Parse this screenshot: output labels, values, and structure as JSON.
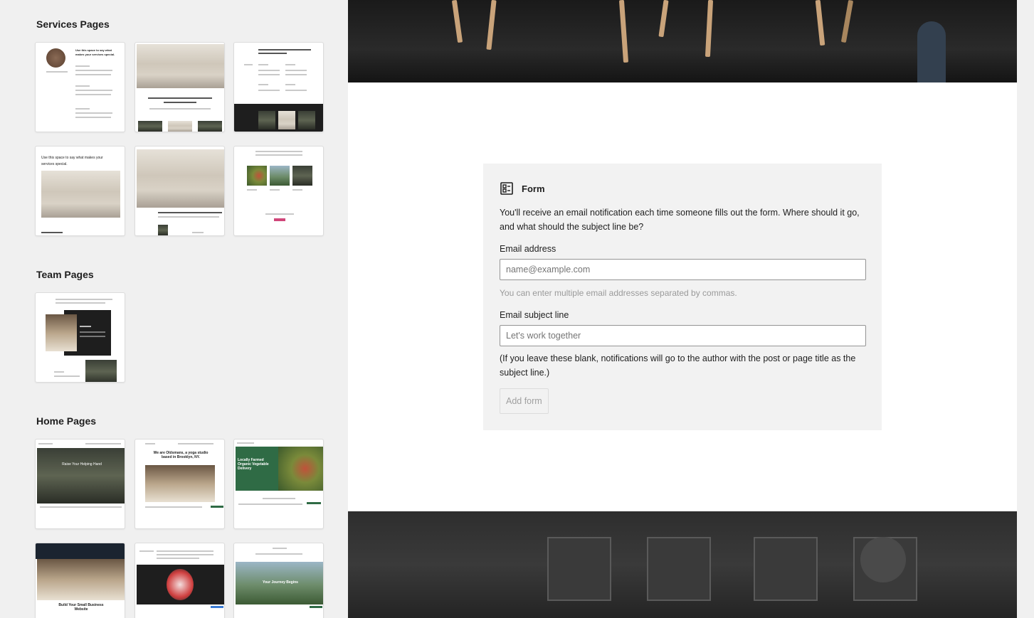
{
  "sidebar": {
    "sections": [
      {
        "title": "Services Pages"
      },
      {
        "title": "Team Pages"
      },
      {
        "title": "Home Pages"
      }
    ],
    "thumbs": {
      "s1_text": "Use this space to say what makes your services special.",
      "s4_text": "Use this space to say what makes your services special.",
      "h1_text": "Raise Your Helping Hand",
      "h2_text": "We are Oldsmans, a yoga studio based in Brooklyn, NY.",
      "h3_text": "Locally Farmed Organic Vegetable Delivery",
      "h4_text": "Build Your Small Business Website",
      "h6_text": "Your Journey Begins"
    }
  },
  "form": {
    "title": "Form",
    "icon": "form-icon",
    "description": "You'll receive an email notification each time someone fills out the form. Where should it go, and what should the subject line be?",
    "email_label": "Email address",
    "email_placeholder": "name@example.com",
    "email_help": "You can enter multiple email addresses separated by commas.",
    "subject_label": "Email subject line",
    "subject_placeholder": "Let's work together",
    "note": "(If you leave these blank, notifications will go to the author with the post or page title as the subject line.)",
    "add_button": "Add form"
  },
  "colors": {
    "accent_green": "#2f6b45",
    "accent_pink": "#d0467a"
  }
}
